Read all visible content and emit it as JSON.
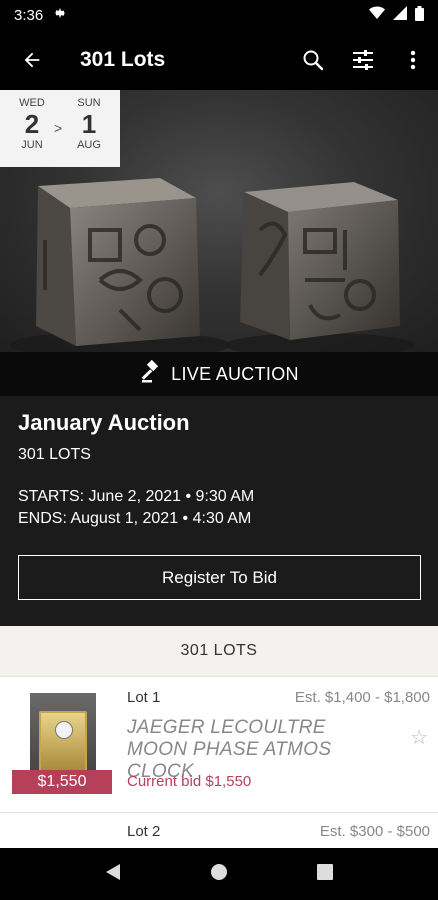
{
  "status_bar": {
    "time": "3:36"
  },
  "app_bar": {
    "title": "301 Lots"
  },
  "date_range": {
    "start": {
      "dow": "WED",
      "day": "2",
      "month": "JUN"
    },
    "separator": ">",
    "end": {
      "dow": "SUN",
      "day": "1",
      "month": "AUG"
    }
  },
  "live_strip": {
    "label": "LIVE AUCTION"
  },
  "auction": {
    "title": "January Auction",
    "lot_count": "301 LOTS",
    "starts": "STARTS: June 2, 2021 • 9:30 AM",
    "ends": "ENDS: August 1, 2021 • 4:30 AM",
    "register_label": "Register To Bid"
  },
  "lots": {
    "header": "301 LOTS",
    "items": [
      {
        "lot": "Lot 1",
        "estimate": "Est. $1,400 - $1,800",
        "name": "JAEGER LECOULTRE MOON PHASE ATMOS CLOCK",
        "current_bid": "Current bid $1,550",
        "price_tag": "$1,550"
      },
      {
        "lot": "Lot 2",
        "estimate": "Est. $300 - $500"
      }
    ]
  },
  "colors": {
    "accent": "#b4405a",
    "app_bg": "#000000",
    "panel_bg": "#1b1b1b",
    "list_bg": "#f4f2ee"
  },
  "icons": [
    "settings-icon",
    "wifi-icon",
    "signal-icon",
    "battery-icon",
    "back-arrow-icon",
    "search-icon",
    "filter-icon",
    "more-vert-icon",
    "gavel-icon",
    "star-icon",
    "nav-back-icon",
    "nav-home-icon",
    "nav-recents-icon"
  ]
}
